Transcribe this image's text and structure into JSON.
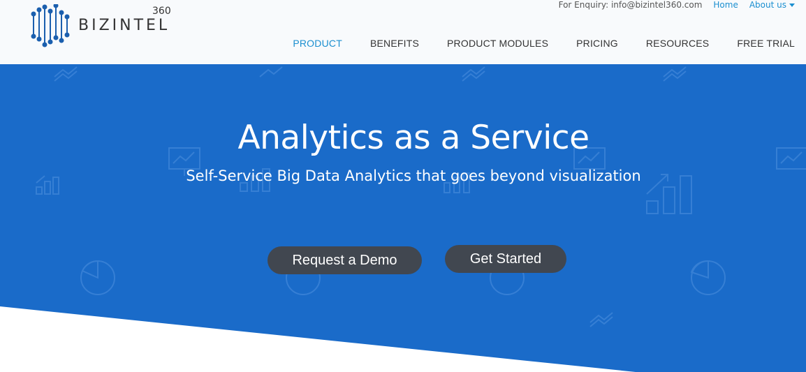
{
  "brand": {
    "name": "BIZINTEL",
    "superscript": "360"
  },
  "topbar": {
    "enquiry": "For Enquiry: info@bizintel360.com",
    "home": "Home",
    "about": "About us"
  },
  "nav": {
    "items": [
      {
        "label": "PRODUCT"
      },
      {
        "label": "BENEFITS"
      },
      {
        "label": "PRODUCT MODULES"
      },
      {
        "label": "PRICING"
      },
      {
        "label": "RESOURCES"
      },
      {
        "label": "FREE TRIAL"
      }
    ],
    "active": "PRODUCT"
  },
  "hero": {
    "title": "Analytics as a Service",
    "subtitle": "Self-Service Big Data Analytics that goes beyond visualization",
    "demo_button": "Request a Demo",
    "start_button": "Get Started"
  },
  "colors": {
    "hero_bg": "#1a6bc9",
    "accent": "#1b8fd0",
    "button_bg": "#414750",
    "header_bg": "#f8fafc"
  },
  "icons": [
    "logo-icon",
    "caret-down-icon",
    "chart-trend-icon",
    "presentation-icon",
    "bar-chart-icon",
    "pie-chart-icon"
  ]
}
